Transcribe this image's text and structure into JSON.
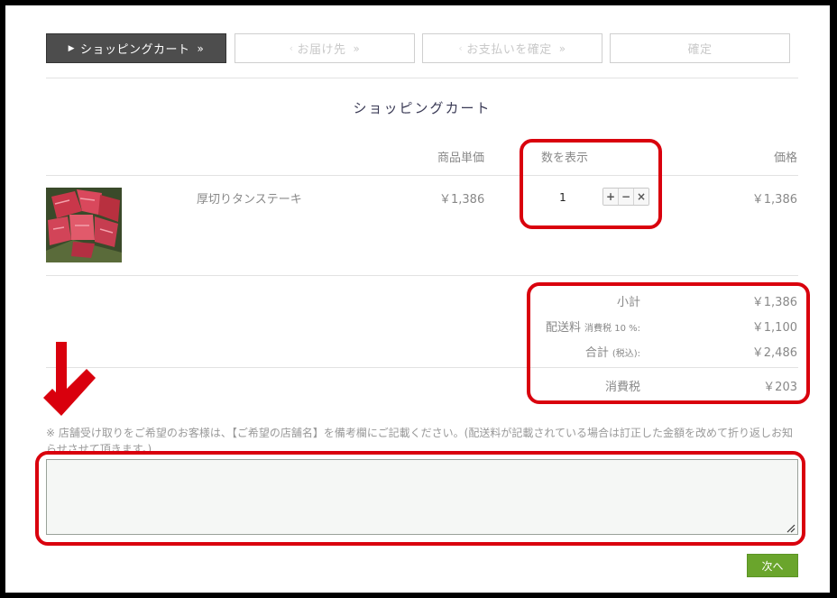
{
  "steps": [
    {
      "label": "ショッピングカート",
      "active": true
    },
    {
      "label": "お届け先",
      "active": false
    },
    {
      "label": "お支払いを確定",
      "active": false
    },
    {
      "label": "確定",
      "active": false
    }
  ],
  "cart": {
    "title": "ショッピングカート",
    "headers": {
      "unit_price": "商品単価",
      "quantity": "数を表示",
      "price": "価格"
    },
    "items": [
      {
        "name": "厚切りタンステーキ",
        "unit_price": "￥1,386",
        "quantity": "1",
        "price": "￥1,386"
      }
    ],
    "qty_controls": {
      "plus": "+",
      "minus": "−",
      "remove": "×"
    }
  },
  "summary": {
    "subtotal_label": "小計",
    "subtotal_value": "￥1,386",
    "shipping_label": "配送料",
    "shipping_tax_note": "消費税 10 %:",
    "shipping_value": "￥1,100",
    "total_label": "合計",
    "total_note": "(税込):",
    "total_value": "￥2,486",
    "tax_label": "消費税",
    "tax_value": "￥203"
  },
  "notice": "※ 店舗受け取りをご希望のお客様は、【ご希望の店舗名】を備考欄にご記載ください。(配送料が記載されている場合は訂正した金額を改めて折り返しお知らせさせて頂きます。)",
  "memo": {
    "value": "",
    "placeholder": ""
  },
  "next_button": "次へ",
  "colors": {
    "active_step": "#4d4d4d",
    "next_button": "#6aa52c",
    "annotation": "#d9000d"
  }
}
